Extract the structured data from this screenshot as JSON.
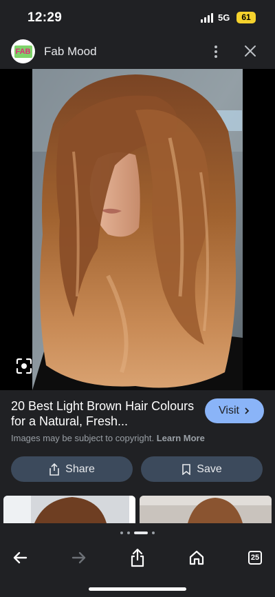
{
  "status_bar": {
    "time": "12:29",
    "network": "5G",
    "battery": "61"
  },
  "source": {
    "logo_text": "FAB",
    "title": "Fab Mood",
    "more_icon": "more-vert-icon",
    "close_icon": "close-icon"
  },
  "image": {
    "lens_icon": "lens-icon"
  },
  "result": {
    "title": "20 Best Light Brown Hair Colours for a Natural, Fresh...",
    "visit_label": "Visit",
    "copyright_text": "Images may be subject to copyright.",
    "learn_more": "Learn More",
    "share_label": "Share",
    "save_label": "Save"
  },
  "toolbar": {
    "back_icon": "back-arrow-icon",
    "forward_icon": "forward-arrow-icon",
    "share_icon": "share-icon",
    "home_icon": "home-icon",
    "tabs_count": "25"
  },
  "colors": {
    "background": "#202124",
    "accent": "#8ab4f8",
    "button_bg": "#3c4a5c",
    "battery": "#f5d22d"
  }
}
